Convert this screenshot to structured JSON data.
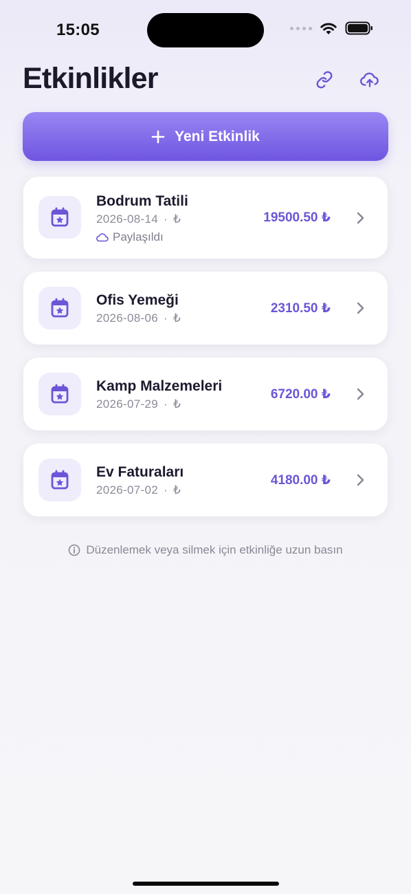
{
  "status": {
    "time": "15:05"
  },
  "header": {
    "title": "Etkinlikler"
  },
  "new_event": {
    "label": "Yeni Etkinlik"
  },
  "events": [
    {
      "name": "Bodrum Tatili",
      "date": "2026-08-14",
      "currency": "₺",
      "amount": "19500.50 ₺",
      "shared_label": "Paylaşıldı"
    },
    {
      "name": "Ofis Yemeği",
      "date": "2026-08-06",
      "currency": "₺",
      "amount": "2310.50 ₺"
    },
    {
      "name": "Kamp Malzemeleri",
      "date": "2026-07-29",
      "currency": "₺",
      "amount": "6720.00 ₺"
    },
    {
      "name": "Ev Faturaları",
      "date": "2026-07-02",
      "currency": "₺",
      "amount": "4180.00 ₺"
    }
  ],
  "hint": {
    "text": "Düzenlemek veya silmek için etkinliğe uzun basın"
  },
  "colors": {
    "accent": "#6f55e0",
    "amount": "#6c55d6",
    "icon_bg": "#efecfc"
  }
}
